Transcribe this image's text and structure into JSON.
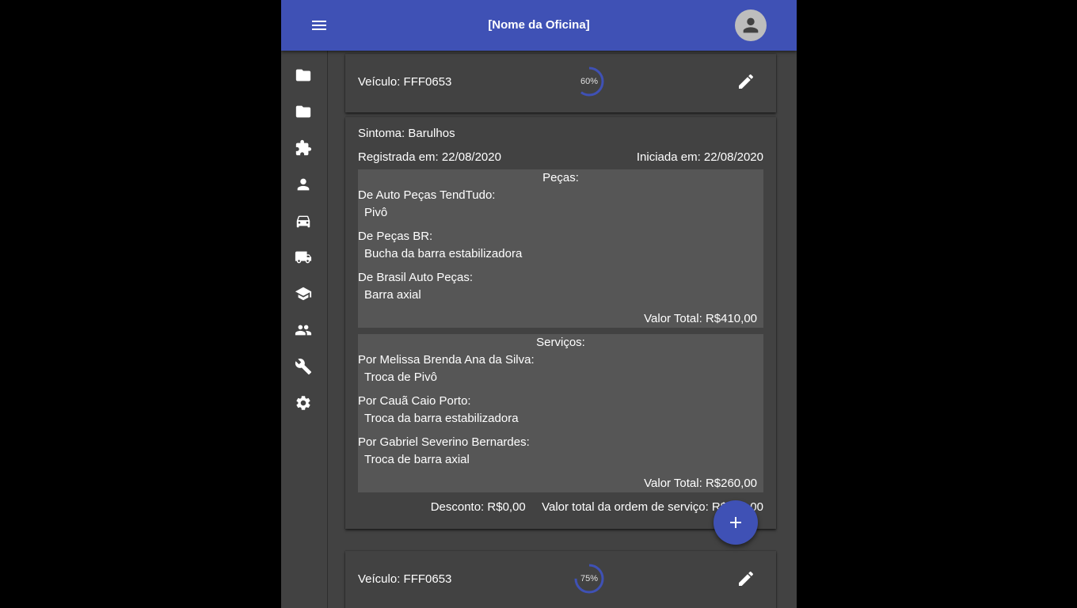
{
  "app": {
    "title": "[Nome da Oficina]"
  },
  "sidebar": {
    "icons": [
      "folder-icon",
      "folder-icon",
      "puzzle-icon",
      "person-icon",
      "car-icon",
      "truck-icon",
      "school-icon",
      "people-icon",
      "wrench-icon",
      "gear-icon"
    ]
  },
  "orders": [
    {
      "vehicle": "Veículo: FFF0653",
      "progress_label": "60%",
      "progress": 0.6,
      "symptom": "Sintoma: Barulhos",
      "registered": "Registrada em: 22/08/2020",
      "started": "Iniciada em: 22/08/2020",
      "parts": {
        "title": "Peças:",
        "groups": [
          {
            "supplier": "De Auto Peças TendTudo:",
            "item": "Pivô"
          },
          {
            "supplier": "De Peças BR:",
            "item": "Bucha da barra estabilizadora"
          },
          {
            "supplier": "De Brasil Auto Peças:",
            "item": "Barra axial"
          }
        ],
        "total": "Valor Total: R$410,00"
      },
      "services": {
        "title": "Serviços:",
        "groups": [
          {
            "worker": "Por Melissa Brenda Ana da Silva:",
            "item": "Troca de Pivô"
          },
          {
            "worker": "Por Cauã Caio Porto:",
            "item": "Troca da barra estabilizadora"
          },
          {
            "worker": "Por Gabriel Severino Bernardes:",
            "item": "Troca de barra axial"
          }
        ],
        "total": "Valor Total: R$260,00"
      },
      "discount": "Desconto: R$0,00",
      "order_total": "Valor total da ordem de serviço: R$670,00"
    },
    {
      "vehicle": "Veículo: FFF0653",
      "progress_label": "75%",
      "progress": 0.75
    }
  ],
  "colors": {
    "primary": "#3f51b5",
    "surface": "#424242",
    "panel": "#565656"
  }
}
